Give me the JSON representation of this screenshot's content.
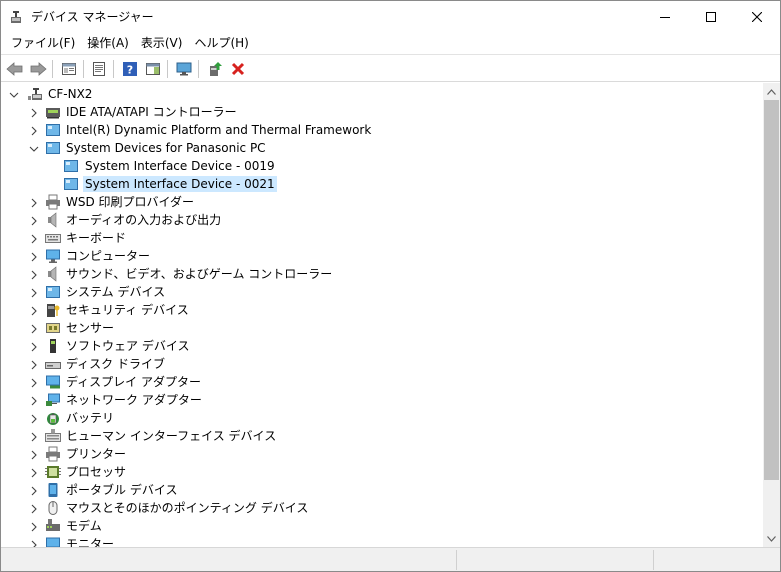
{
  "window": {
    "title": "デバイス マネージャー",
    "icon": "device-manager-icon"
  },
  "menu": [
    {
      "label": "ファイル(F)"
    },
    {
      "label": "操作(A)"
    },
    {
      "label": "表示(V)"
    },
    {
      "label": "ヘルプ(H)"
    }
  ],
  "toolbar": [
    {
      "icon": "back-arrow-icon"
    },
    {
      "icon": "forward-arrow-icon"
    },
    {
      "icon": "properties-sheet-icon"
    },
    {
      "icon": "show-hide-console-tree-icon"
    },
    {
      "icon": "help-icon"
    },
    {
      "icon": "action-pane-icon"
    },
    {
      "icon": "scan-hardware-changes-icon"
    },
    {
      "icon": "update-driver-icon"
    },
    {
      "icon": "uninstall-device-icon"
    }
  ],
  "tree": {
    "root": {
      "label": "CF-NX2",
      "icon": "computer-icon",
      "expanded": true
    },
    "categories": [
      {
        "label": "IDE ATA/ATAPI コントローラー",
        "icon": "ide-controller-icon",
        "expanded": false
      },
      {
        "label": "Intel(R) Dynamic Platform and Thermal Framework",
        "icon": "system-device-icon",
        "expanded": false
      },
      {
        "label": "System Devices for Panasonic PC",
        "icon": "system-device-icon",
        "expanded": true,
        "children": [
          {
            "label": "System Interface Device - 0019",
            "icon": "system-device-icon",
            "selected": false
          },
          {
            "label": "System Interface Device - 0021",
            "icon": "system-device-icon",
            "selected": true
          }
        ]
      },
      {
        "label": "WSD 印刷プロバイダー",
        "icon": "printer-icon",
        "expanded": false
      },
      {
        "label": "オーディオの入力および出力",
        "icon": "speaker-icon",
        "expanded": false
      },
      {
        "label": "キーボード",
        "icon": "keyboard-icon",
        "expanded": false
      },
      {
        "label": "コンピューター",
        "icon": "monitor-icon",
        "expanded": false
      },
      {
        "label": "サウンド、ビデオ、およびゲーム コントローラー",
        "icon": "speaker-icon",
        "expanded": false
      },
      {
        "label": "システム デバイス",
        "icon": "system-device-icon",
        "expanded": false
      },
      {
        "label": "セキュリティ デバイス",
        "icon": "security-key-icon",
        "expanded": false
      },
      {
        "label": "センサー",
        "icon": "sensor-icon",
        "expanded": false
      },
      {
        "label": "ソフトウェア デバイス",
        "icon": "software-device-icon",
        "expanded": false
      },
      {
        "label": "ディスク ドライブ",
        "icon": "disk-drive-icon",
        "expanded": false
      },
      {
        "label": "ディスプレイ アダプター",
        "icon": "display-adapter-icon",
        "expanded": false
      },
      {
        "label": "ネットワーク アダプター",
        "icon": "network-adapter-icon",
        "expanded": false
      },
      {
        "label": "バッテリ",
        "icon": "battery-icon",
        "expanded": false
      },
      {
        "label": "ヒューマン インターフェイス デバイス",
        "icon": "hid-icon",
        "expanded": false
      },
      {
        "label": "プリンター",
        "icon": "printer-icon",
        "expanded": false
      },
      {
        "label": "プロセッサ",
        "icon": "processor-icon",
        "expanded": false
      },
      {
        "label": "ポータブル デバイス",
        "icon": "portable-device-icon",
        "expanded": false
      },
      {
        "label": "マウスとそのほかのポインティング デバイス",
        "icon": "mouse-icon",
        "expanded": false
      },
      {
        "label": "モデム",
        "icon": "modem-icon",
        "expanded": false
      },
      {
        "label": "モニター",
        "icon": "monitor-icon",
        "expanded": false
      }
    ]
  },
  "colors": {
    "selection": "#cce8ff",
    "close_red": "#e81123"
  }
}
